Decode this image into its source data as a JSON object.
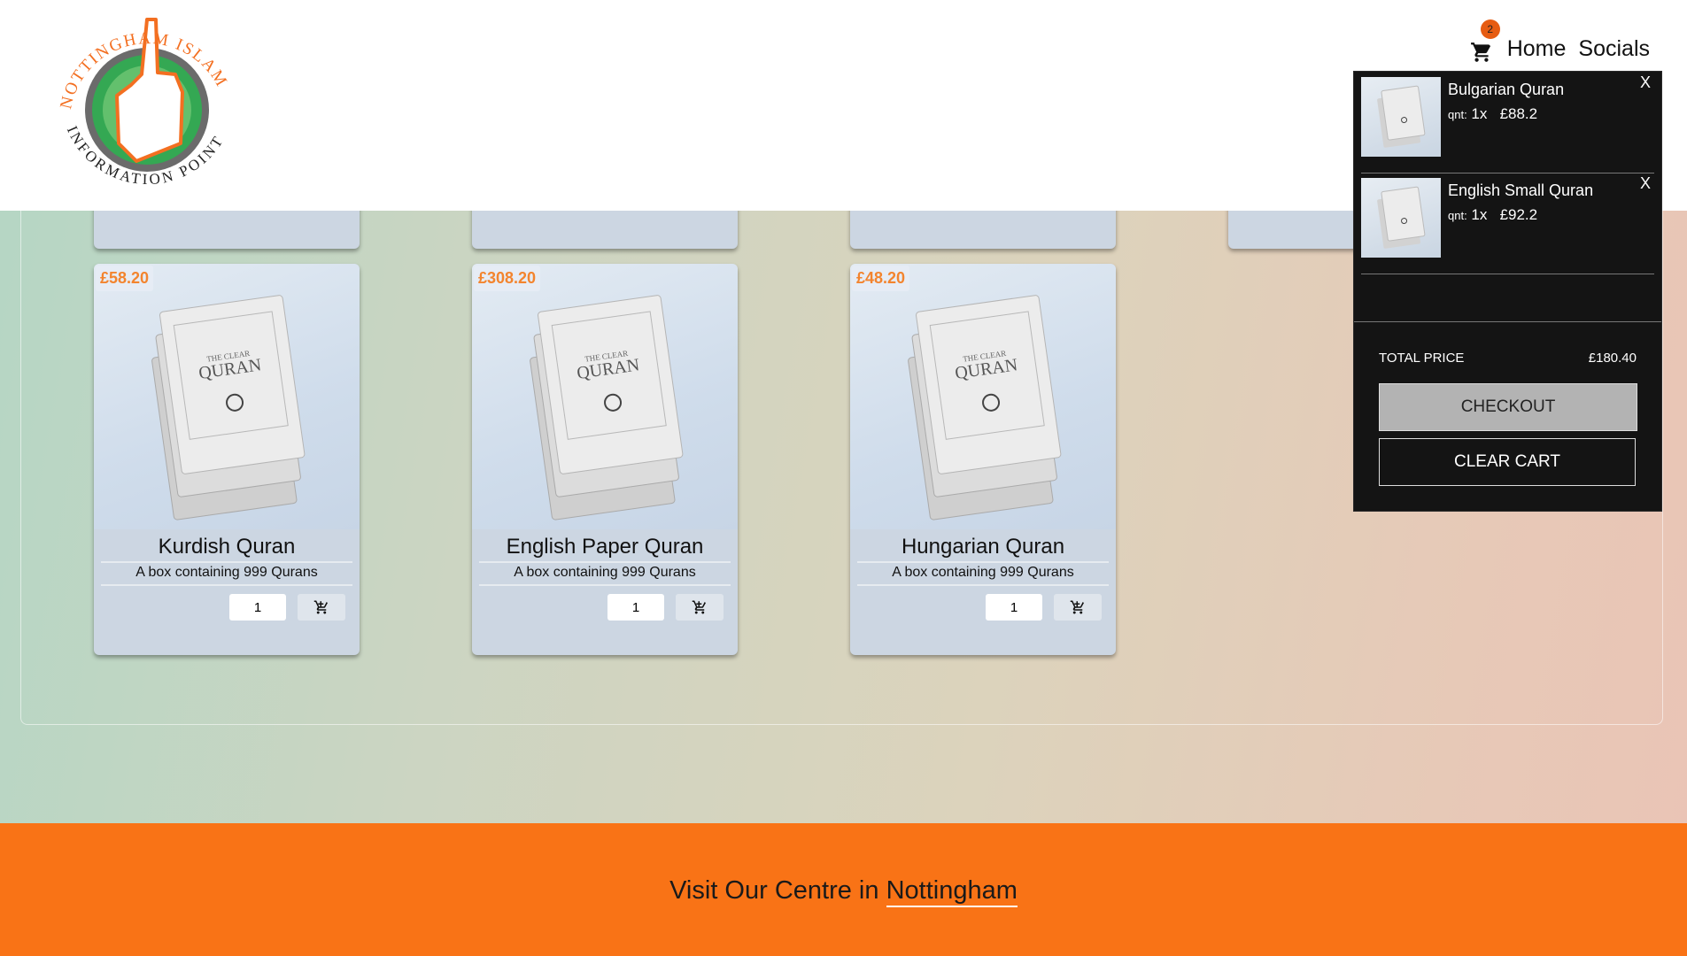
{
  "nav": {
    "cart_count": "2",
    "home_label": "Home",
    "socials_label": "Socials"
  },
  "logo": {
    "top_text": "NOTTINGHAM ISLAM",
    "bottom_text": "INFORMATION POINT"
  },
  "products": [
    {
      "price": "£58.20",
      "name": "Kurdish Quran",
      "description": "A box containing 999 Qurans",
      "qty": "1"
    },
    {
      "price": "£308.20",
      "name": "English Paper Quran",
      "description": "A box containing 999 Qurans",
      "qty": "1"
    },
    {
      "price": "£48.20",
      "name": "Hungarian Quran",
      "description": "A box containing 999 Qurans",
      "qty": "1"
    }
  ],
  "cart": {
    "items": [
      {
        "name": "Bulgarian Quran",
        "qty_label": "qnt:",
        "qty": "1x",
        "price": "£88.2",
        "remove": "X"
      },
      {
        "name": "English Small Quran",
        "qty_label": "qnt:",
        "qty": "1x",
        "price": "£92.2",
        "remove": "X"
      }
    ],
    "total_label": "TOTAL PRICE",
    "total_value": "£180.40",
    "checkout_label": "CHECKOUT",
    "clear_label": "CLEAR CART"
  },
  "footer": {
    "text": "Visit Our Centre in ",
    "link": "Nottingham"
  },
  "colors": {
    "accent": "#f97316",
    "price": "#f3842e"
  }
}
